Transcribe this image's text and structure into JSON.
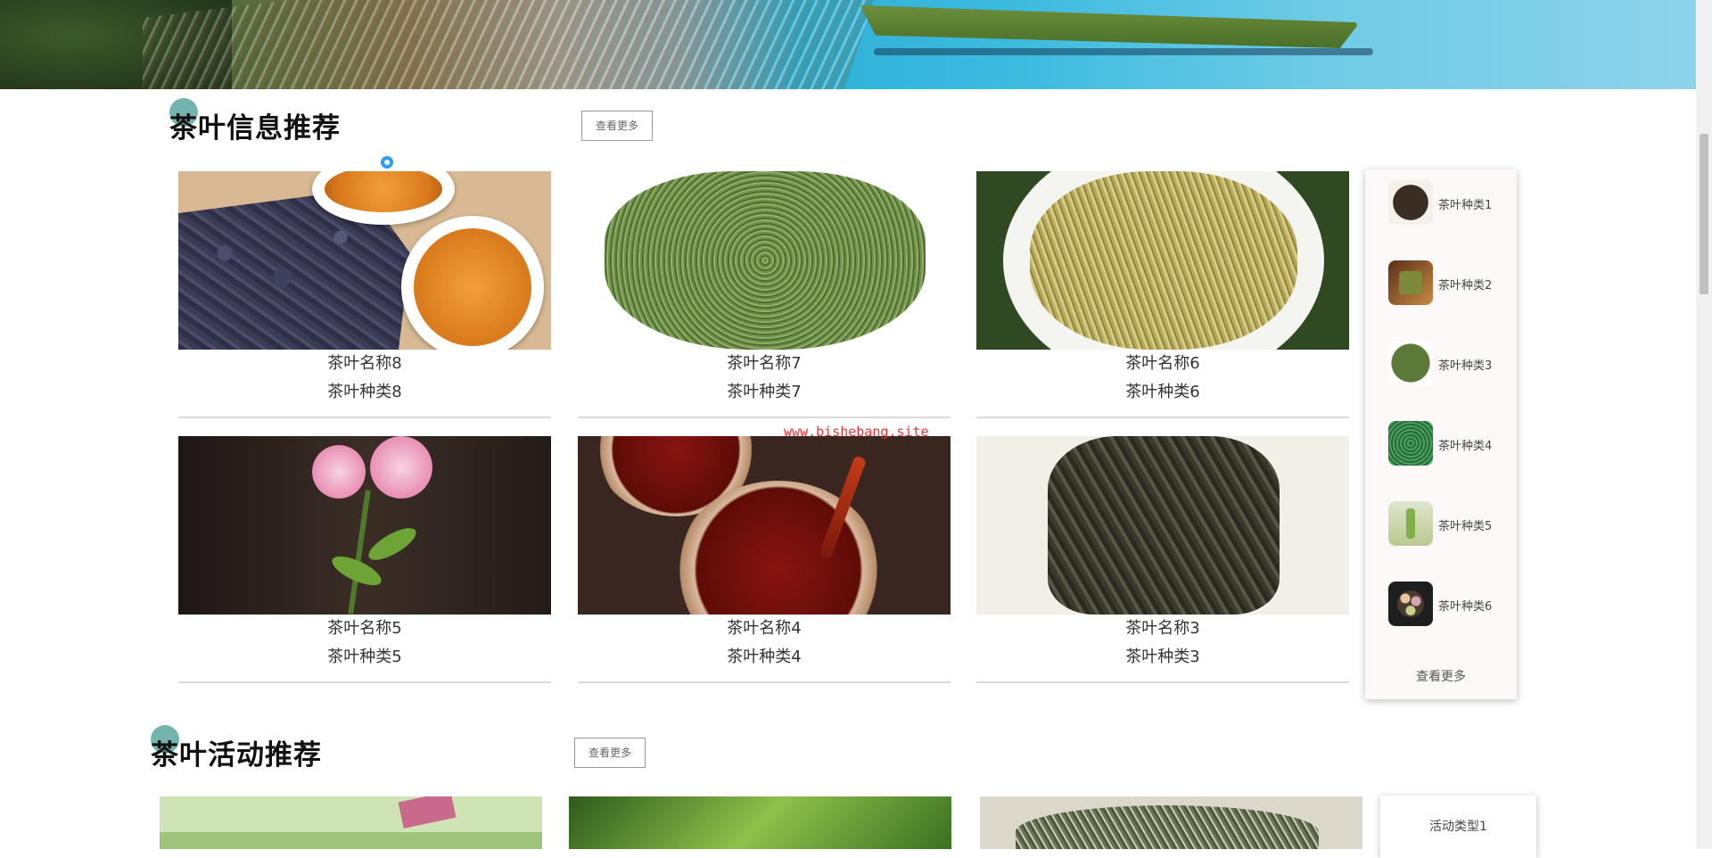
{
  "section_tea": {
    "title": "茶叶信息推荐",
    "more_label": "查看更多",
    "cards": [
      {
        "name": "茶叶名称8",
        "kind": "茶叶种类8"
      },
      {
        "name": "茶叶名称7",
        "kind": "茶叶种类7"
      },
      {
        "name": "茶叶名称6",
        "kind": "茶叶种类6"
      },
      {
        "name": "茶叶名称5",
        "kind": "茶叶种类5"
      },
      {
        "name": "茶叶名称4",
        "kind": "茶叶种类4"
      },
      {
        "name": "茶叶名称3",
        "kind": "茶叶种类3"
      }
    ],
    "side": {
      "items": [
        {
          "label": "茶叶种类1"
        },
        {
          "label": "茶叶种类2"
        },
        {
          "label": "茶叶种类3"
        },
        {
          "label": "茶叶种类4"
        },
        {
          "label": "茶叶种类5"
        },
        {
          "label": "茶叶种类6"
        }
      ],
      "more_label": "查看更多"
    }
  },
  "section_activity": {
    "title": "茶叶活动推荐",
    "more_label": "查看更多",
    "side": {
      "items": [
        {
          "label": "活动类型1"
        }
      ]
    }
  },
  "watermark": "www.bishebang.site",
  "colors": {
    "accent_dot": "#5aa7a0",
    "watermark": "#ee3333"
  }
}
